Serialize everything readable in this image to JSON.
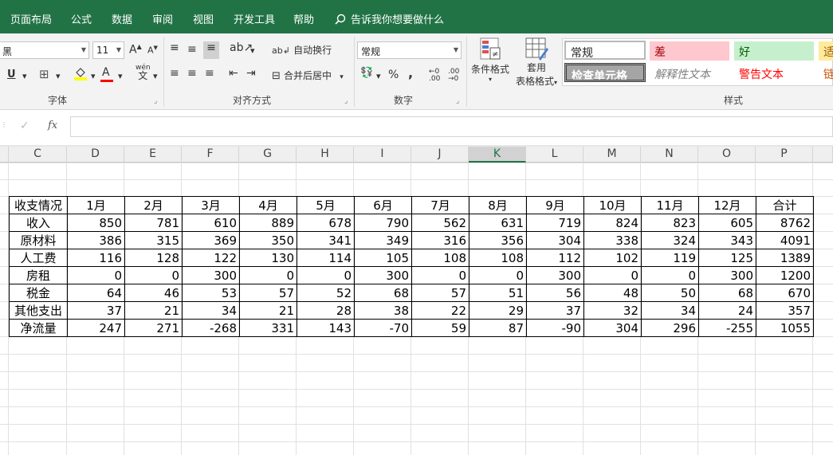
{
  "tabs": [
    "页面布局",
    "公式",
    "数据",
    "审阅",
    "视图",
    "开发工具",
    "帮助"
  ],
  "tell_me": "告诉我你想要做什么",
  "ribbon": {
    "font_name": "黑",
    "font_size": "11",
    "grow_font": "A",
    "shrink_font": "A",
    "underline": "U",
    "font_color_letter": "A",
    "phonetic": "wén",
    "phonetic_char": "文",
    "wrap_text": "自动换行",
    "merge_center": "合并后居中",
    "number_format": "常规",
    "percent": "%",
    "comma": ",",
    "cond_format": "条件格式",
    "table_format_1": "套用",
    "table_format_2": "表格格式",
    "groups": {
      "font": "字体",
      "align": "对齐方式",
      "number": "数字",
      "styles": "样式"
    },
    "styles": {
      "normal": "常规",
      "bad": "差",
      "good": "好",
      "neutral": "适",
      "check_cell": "检查单元格",
      "explanatory": "解释性文本",
      "warning": "警告文本",
      "link": "链"
    },
    "colors": {
      "bad_bg": "#ffc7ce",
      "bad_fg": "#9c0006",
      "good_bg": "#c6efce",
      "good_fg": "#006100",
      "neutral_bg": "#ffeb9c",
      "neutral_fg": "#9c5700",
      "warning_fg": "#ff0000",
      "check_bg": "#a5a5a5"
    }
  },
  "formula_bar": {
    "fx": "fx",
    "cancel": "✓",
    "value": ""
  },
  "columns": [
    "C",
    "D",
    "E",
    "F",
    "G",
    "H",
    "I",
    "J",
    "K",
    "L",
    "M",
    "N",
    "O",
    "P"
  ],
  "active_column": "K",
  "table": {
    "header": [
      "收支情况",
      "1月",
      "2月",
      "3月",
      "4月",
      "5月",
      "6月",
      "7月",
      "8月",
      "9月",
      "10月",
      "11月",
      "12月",
      "合计"
    ],
    "rows": [
      [
        "收入",
        "850",
        "781",
        "610",
        "889",
        "678",
        "790",
        "562",
        "631",
        "719",
        "824",
        "823",
        "605",
        "8762"
      ],
      [
        "原材料",
        "386",
        "315",
        "369",
        "350",
        "341",
        "349",
        "316",
        "356",
        "304",
        "338",
        "324",
        "343",
        "4091"
      ],
      [
        "人工费",
        "116",
        "128",
        "122",
        "130",
        "114",
        "105",
        "108",
        "108",
        "112",
        "102",
        "119",
        "125",
        "1389"
      ],
      [
        "房租",
        "0",
        "0",
        "300",
        "0",
        "0",
        "300",
        "0",
        "0",
        "300",
        "0",
        "0",
        "300",
        "1200"
      ],
      [
        "税金",
        "64",
        "46",
        "53",
        "57",
        "52",
        "68",
        "57",
        "51",
        "56",
        "48",
        "50",
        "68",
        "670"
      ],
      [
        "其他支出",
        "37",
        "21",
        "34",
        "21",
        "28",
        "38",
        "22",
        "29",
        "37",
        "32",
        "34",
        "24",
        "357"
      ],
      [
        "净流量",
        "247",
        "271",
        "-268",
        "331",
        "143",
        "-70",
        "59",
        "87",
        "-90",
        "304",
        "296",
        "-255",
        "1055"
      ]
    ]
  }
}
